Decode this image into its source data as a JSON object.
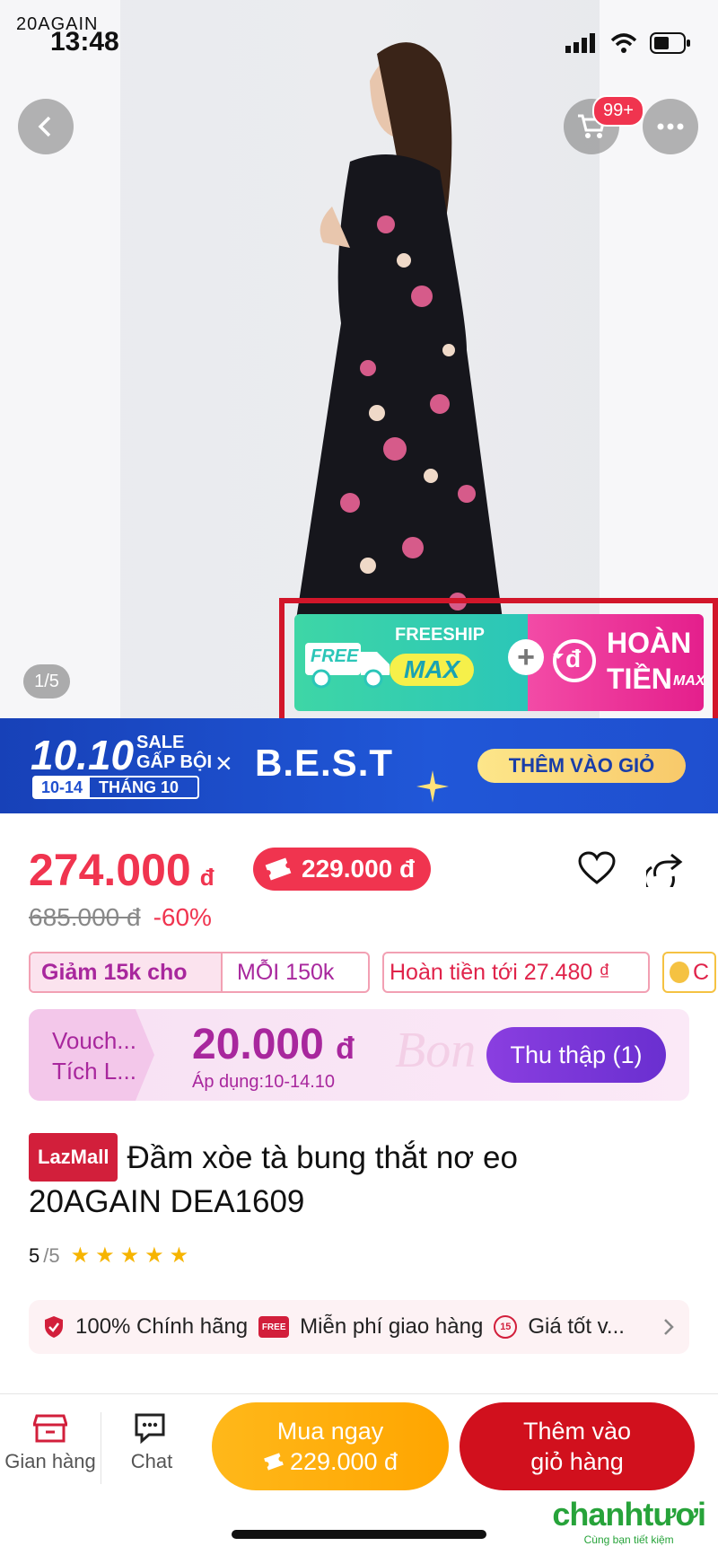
{
  "status": {
    "brand": "20AGAIN",
    "time": "13:48"
  },
  "header": {
    "cart_badge": "99+"
  },
  "gallery": {
    "page_indicator": "1/5"
  },
  "promo": {
    "freeship_badge": "FREE",
    "freeship_title": "FREESHIP",
    "freeship_max": "MAX",
    "plus": "+",
    "cashback_icon": "đ",
    "cashback_line1": "HOÀN",
    "cashback_line2": "TIỀN",
    "cashback_max": "MAX"
  },
  "sale_banner": {
    "date_big": "10.10",
    "sale_line1": "SALE",
    "sale_line2": "GẤP BỘI",
    "range": "10-14",
    "month": "THÁNG 10",
    "times": "×",
    "brand": "B.E.S.T",
    "cta": "THÊM VÀO GIỎ"
  },
  "price": {
    "current": "274.000",
    "currency": "đ",
    "voucher_price": "229.000 đ",
    "original": "685.000 đ",
    "discount": "-60%"
  },
  "chips": {
    "discount_label": "Giảm 15k cho",
    "discount_cond": "MỖI 150k",
    "cashback": "Hoàn tiền tới 27.480 ₫",
    "coin": "C"
  },
  "voucher": {
    "label_line1": "Vouch...",
    "label_line2": "Tích L...",
    "amount": "20.000",
    "currency": "đ",
    "apply": "Áp dụng:10-14.10",
    "watermark": "Bon",
    "button": "Thu thập (1)"
  },
  "product": {
    "badge": "LazMall",
    "title": "Đầm xòe tà bung thắt nơ eo 20AGAIN DEA1609",
    "rating": "5",
    "rating_total": "/5"
  },
  "guarantee": {
    "item1": "100% Chính hãng",
    "item2": "Miễn phí giao hàng",
    "item3": "Giá tốt v...",
    "free_icon_text": "FREE",
    "days_icon_text": "15"
  },
  "bottom": {
    "store": "Gian hàng",
    "chat": "Chat",
    "buy_now": "Mua ngay",
    "buy_price": "229.000 đ",
    "add_line1": "Thêm vào",
    "add_line2": "giỏ hàng"
  },
  "watermark": {
    "brand": "chanhtươi",
    "tagline": "Cùng bạn tiết kiệm"
  },
  "colors": {
    "accent": "#f0344f",
    "cta_red": "#d1101d",
    "cta_orange": "#ffa500",
    "voucher_purple": "#a8279d",
    "banner_blue": "#1f4fcf"
  }
}
